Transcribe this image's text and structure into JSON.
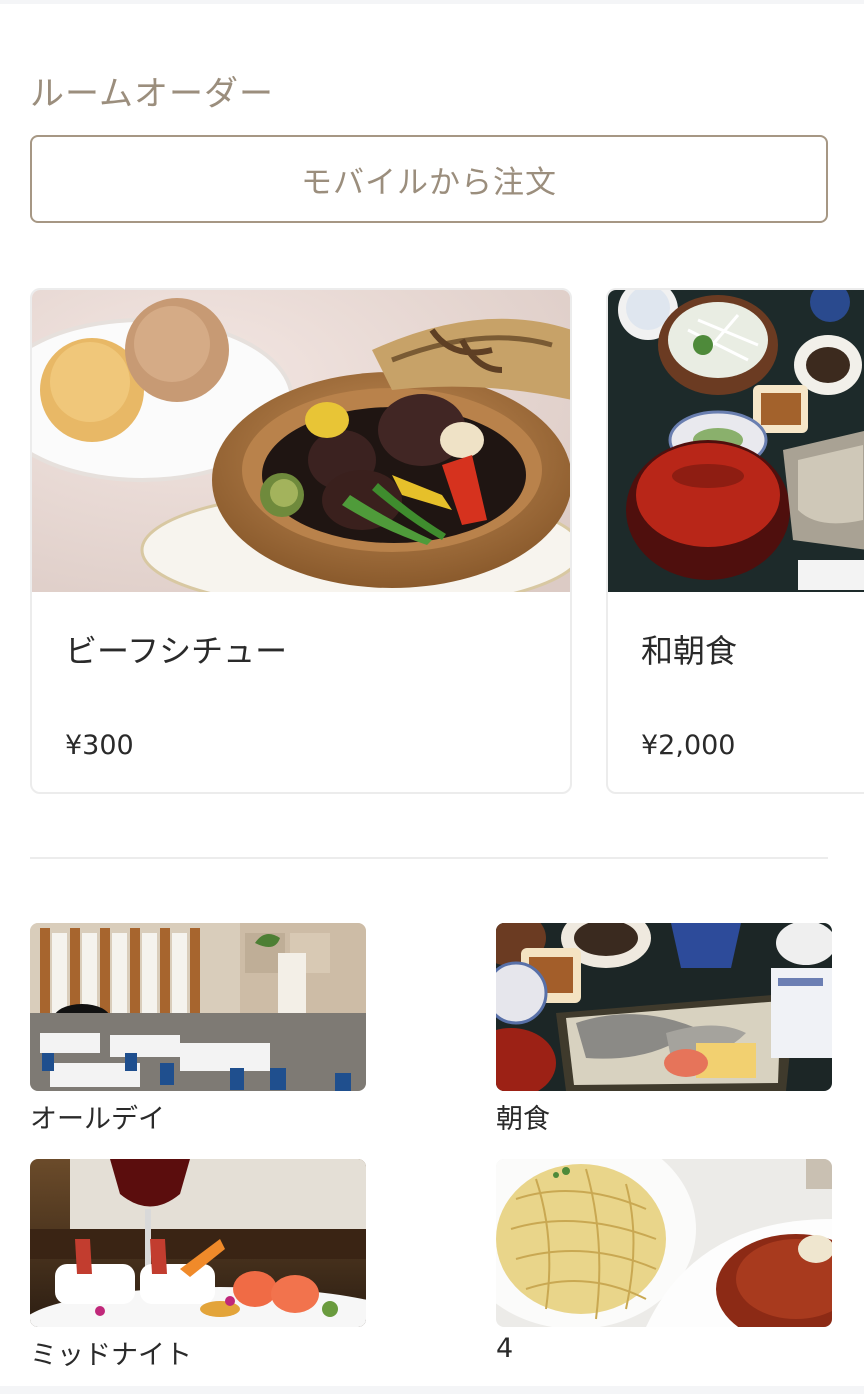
{
  "header": {
    "title": "ルームオーダー",
    "mobile_order_label": "モバイルから注文"
  },
  "featured": [
    {
      "name": "ビーフシチュー",
      "price": "¥300",
      "image": "beef-stew-photo"
    },
    {
      "name": "和朝食",
      "price": "¥2,000",
      "image": "japanese-breakfast-photo"
    }
  ],
  "categories": [
    {
      "label": "オールデイ",
      "image": "dining-hall-photo"
    },
    {
      "label": "朝食",
      "image": "breakfast-photo"
    },
    {
      "label": "ミッドナイト",
      "image": "midnight-plate-photo"
    },
    {
      "label": "4",
      "image": "pasta-photo"
    }
  ],
  "colors": {
    "accent": "#9b8e7d",
    "border": "#a69784",
    "text": "#2a2a2a"
  }
}
